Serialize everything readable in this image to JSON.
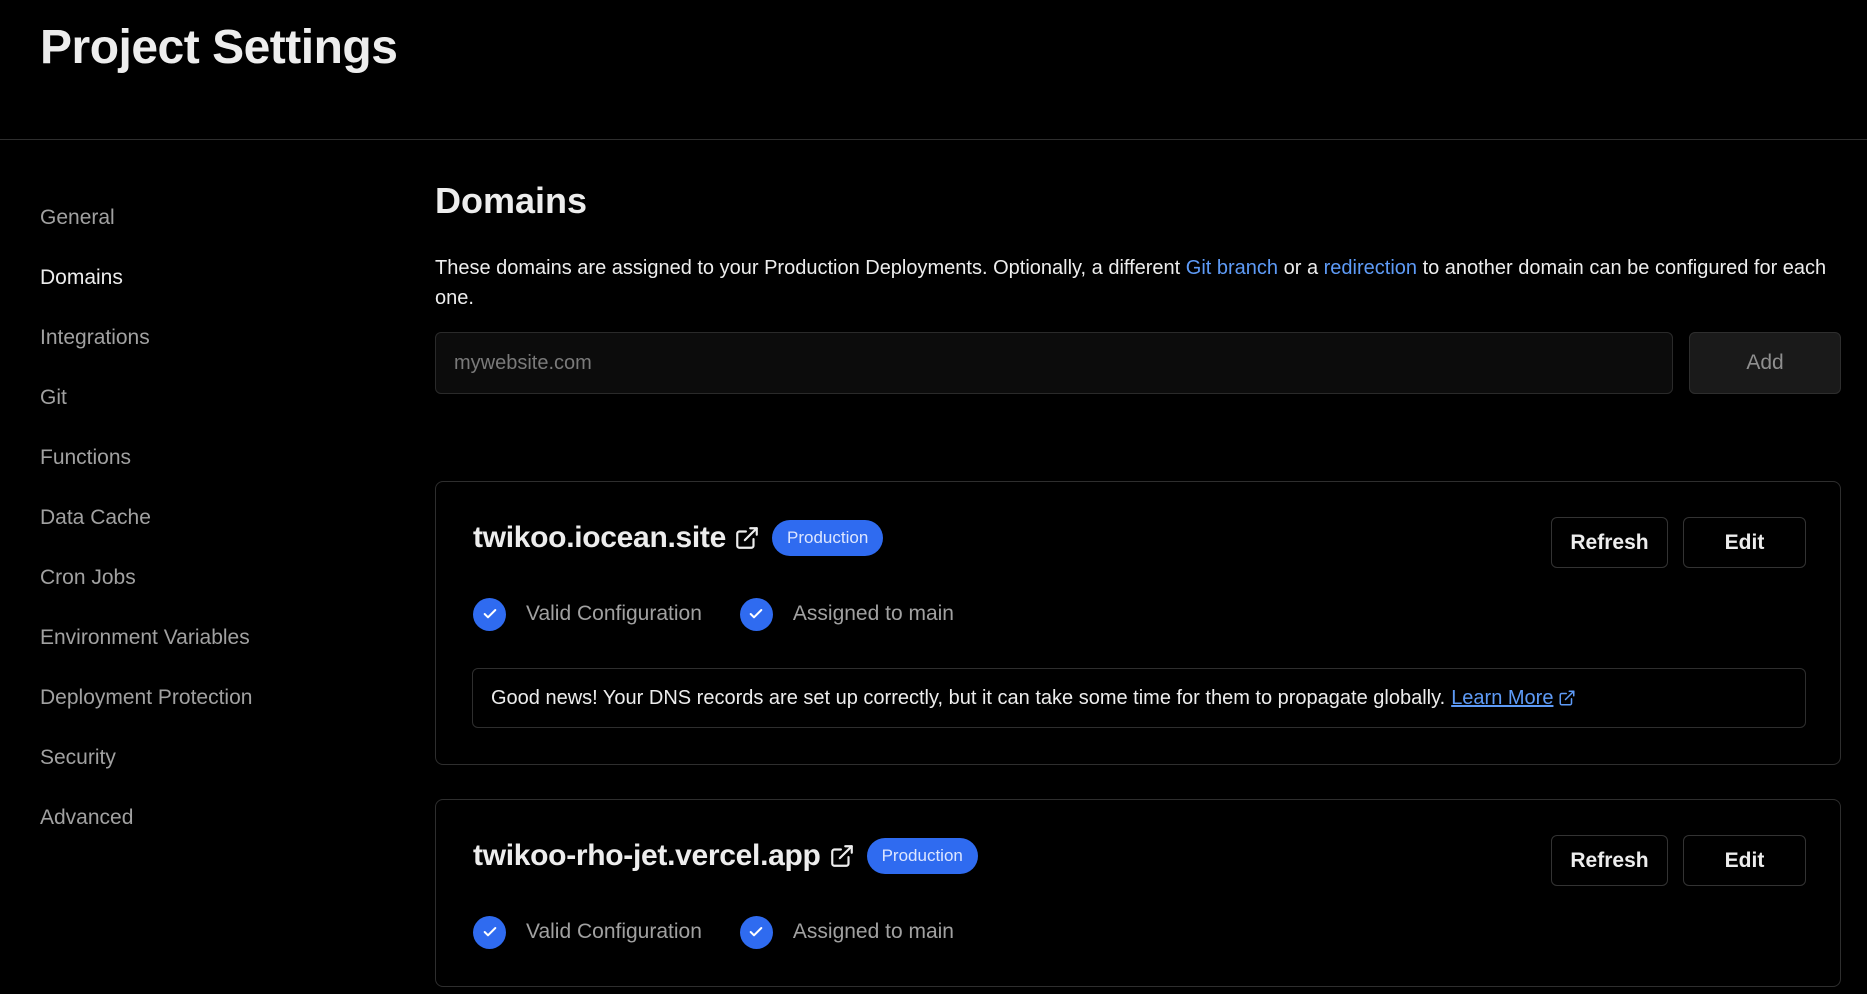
{
  "header": {
    "title": "Project Settings"
  },
  "sidebar": {
    "items": [
      {
        "label": "General"
      },
      {
        "label": "Domains"
      },
      {
        "label": "Integrations"
      },
      {
        "label": "Git"
      },
      {
        "label": "Functions"
      },
      {
        "label": "Data Cache"
      },
      {
        "label": "Cron Jobs"
      },
      {
        "label": "Environment Variables"
      },
      {
        "label": "Deployment Protection"
      },
      {
        "label": "Security"
      },
      {
        "label": "Advanced"
      }
    ],
    "active": "Domains"
  },
  "main": {
    "title": "Domains",
    "description": {
      "part1": "These domains are assigned to your Production Deployments. Optionally, a different ",
      "link1": "Git branch",
      "part2": " or a ",
      "link2": "redirection",
      "part3": " to another domain can be configured for each one."
    },
    "input": {
      "placeholder": "mywebsite.com",
      "value": ""
    },
    "add_label": "Add",
    "domains": [
      {
        "name": "twikoo.iocean.site",
        "badge": "Production",
        "refresh_label": "Refresh",
        "edit_label": "Edit",
        "status": [
          "Valid Configuration",
          "Assigned to main"
        ],
        "note": "Good news! Your DNS records are set up correctly, but it can take some time for them to propagate globally.",
        "note_link": "Learn More"
      },
      {
        "name": "twikoo-rho-jet.vercel.app",
        "badge": "Production",
        "refresh_label": "Refresh",
        "edit_label": "Edit",
        "status": [
          "Valid Configuration",
          "Assigned to main"
        ]
      }
    ]
  },
  "icons": {
    "external_link": "external-link-icon",
    "check": "check-circle-icon"
  },
  "colors": {
    "background": "#000000",
    "accent": "#2f6bf0",
    "link": "#5e9bf7",
    "muted_text": "#a1a1a1",
    "border": "#2e2e2e"
  }
}
